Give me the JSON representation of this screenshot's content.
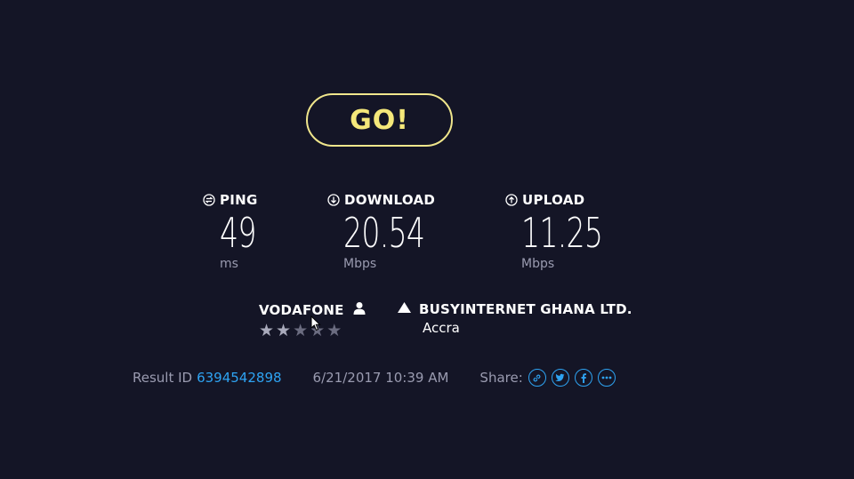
{
  "go_button": {
    "label": "GO!"
  },
  "metrics": {
    "ping": {
      "label": "PING",
      "value": "49",
      "unit": "ms",
      "icon": "ping-icon"
    },
    "download": {
      "label": "DOWNLOAD",
      "value": "20.54",
      "unit": "Mbps",
      "icon": "download-arrow-icon"
    },
    "upload": {
      "label": "UPLOAD",
      "value": "11.25",
      "unit": "Mbps",
      "icon": "upload-arrow-icon"
    }
  },
  "isp": {
    "name": "VODAFONE",
    "icon": "user-icon",
    "rating": 2,
    "rating_max": 5
  },
  "server": {
    "name": "BUSYINTERNET GHANA LTD.",
    "location": "Accra",
    "icon": "server-icon"
  },
  "footer": {
    "result_label": "Result ID",
    "result_id": "6394542898",
    "timestamp": "6/21/2017 10:39 AM",
    "share_label": "Share:",
    "share_icons": [
      "link-icon",
      "twitter-icon",
      "facebook-icon",
      "more-icon"
    ]
  },
  "colors": {
    "background": "#141526",
    "go_accent": "#f5e87a",
    "link": "#2ea3f2",
    "muted": "#9a9bb0"
  }
}
